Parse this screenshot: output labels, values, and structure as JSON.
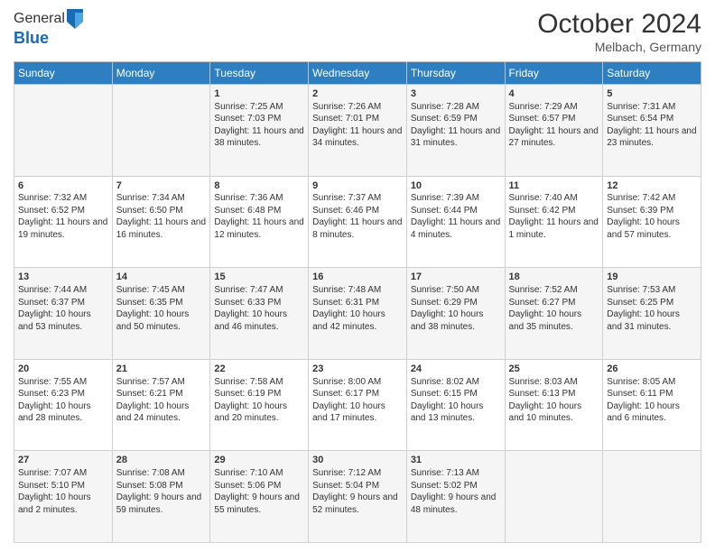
{
  "header": {
    "logo_line1": "General",
    "logo_line2": "Blue",
    "month": "October 2024",
    "location": "Melbach, Germany"
  },
  "days_of_week": [
    "Sunday",
    "Monday",
    "Tuesday",
    "Wednesday",
    "Thursday",
    "Friday",
    "Saturday"
  ],
  "weeks": [
    [
      {
        "day": "",
        "info": ""
      },
      {
        "day": "",
        "info": ""
      },
      {
        "day": "1",
        "info": "Sunrise: 7:25 AM\nSunset: 7:03 PM\nDaylight: 11 hours and 38 minutes."
      },
      {
        "day": "2",
        "info": "Sunrise: 7:26 AM\nSunset: 7:01 PM\nDaylight: 11 hours and 34 minutes."
      },
      {
        "day": "3",
        "info": "Sunrise: 7:28 AM\nSunset: 6:59 PM\nDaylight: 11 hours and 31 minutes."
      },
      {
        "day": "4",
        "info": "Sunrise: 7:29 AM\nSunset: 6:57 PM\nDaylight: 11 hours and 27 minutes."
      },
      {
        "day": "5",
        "info": "Sunrise: 7:31 AM\nSunset: 6:54 PM\nDaylight: 11 hours and 23 minutes."
      }
    ],
    [
      {
        "day": "6",
        "info": "Sunrise: 7:32 AM\nSunset: 6:52 PM\nDaylight: 11 hours and 19 minutes."
      },
      {
        "day": "7",
        "info": "Sunrise: 7:34 AM\nSunset: 6:50 PM\nDaylight: 11 hours and 16 minutes."
      },
      {
        "day": "8",
        "info": "Sunrise: 7:36 AM\nSunset: 6:48 PM\nDaylight: 11 hours and 12 minutes."
      },
      {
        "day": "9",
        "info": "Sunrise: 7:37 AM\nSunset: 6:46 PM\nDaylight: 11 hours and 8 minutes."
      },
      {
        "day": "10",
        "info": "Sunrise: 7:39 AM\nSunset: 6:44 PM\nDaylight: 11 hours and 4 minutes."
      },
      {
        "day": "11",
        "info": "Sunrise: 7:40 AM\nSunset: 6:42 PM\nDaylight: 11 hours and 1 minute."
      },
      {
        "day": "12",
        "info": "Sunrise: 7:42 AM\nSunset: 6:39 PM\nDaylight: 10 hours and 57 minutes."
      }
    ],
    [
      {
        "day": "13",
        "info": "Sunrise: 7:44 AM\nSunset: 6:37 PM\nDaylight: 10 hours and 53 minutes."
      },
      {
        "day": "14",
        "info": "Sunrise: 7:45 AM\nSunset: 6:35 PM\nDaylight: 10 hours and 50 minutes."
      },
      {
        "day": "15",
        "info": "Sunrise: 7:47 AM\nSunset: 6:33 PM\nDaylight: 10 hours and 46 minutes."
      },
      {
        "day": "16",
        "info": "Sunrise: 7:48 AM\nSunset: 6:31 PM\nDaylight: 10 hours and 42 minutes."
      },
      {
        "day": "17",
        "info": "Sunrise: 7:50 AM\nSunset: 6:29 PM\nDaylight: 10 hours and 38 minutes."
      },
      {
        "day": "18",
        "info": "Sunrise: 7:52 AM\nSunset: 6:27 PM\nDaylight: 10 hours and 35 minutes."
      },
      {
        "day": "19",
        "info": "Sunrise: 7:53 AM\nSunset: 6:25 PM\nDaylight: 10 hours and 31 minutes."
      }
    ],
    [
      {
        "day": "20",
        "info": "Sunrise: 7:55 AM\nSunset: 6:23 PM\nDaylight: 10 hours and 28 minutes."
      },
      {
        "day": "21",
        "info": "Sunrise: 7:57 AM\nSunset: 6:21 PM\nDaylight: 10 hours and 24 minutes."
      },
      {
        "day": "22",
        "info": "Sunrise: 7:58 AM\nSunset: 6:19 PM\nDaylight: 10 hours and 20 minutes."
      },
      {
        "day": "23",
        "info": "Sunrise: 8:00 AM\nSunset: 6:17 PM\nDaylight: 10 hours and 17 minutes."
      },
      {
        "day": "24",
        "info": "Sunrise: 8:02 AM\nSunset: 6:15 PM\nDaylight: 10 hours and 13 minutes."
      },
      {
        "day": "25",
        "info": "Sunrise: 8:03 AM\nSunset: 6:13 PM\nDaylight: 10 hours and 10 minutes."
      },
      {
        "day": "26",
        "info": "Sunrise: 8:05 AM\nSunset: 6:11 PM\nDaylight: 10 hours and 6 minutes."
      }
    ],
    [
      {
        "day": "27",
        "info": "Sunrise: 7:07 AM\nSunset: 5:10 PM\nDaylight: 10 hours and 2 minutes."
      },
      {
        "day": "28",
        "info": "Sunrise: 7:08 AM\nSunset: 5:08 PM\nDaylight: 9 hours and 59 minutes."
      },
      {
        "day": "29",
        "info": "Sunrise: 7:10 AM\nSunset: 5:06 PM\nDaylight: 9 hours and 55 minutes."
      },
      {
        "day": "30",
        "info": "Sunrise: 7:12 AM\nSunset: 5:04 PM\nDaylight: 9 hours and 52 minutes."
      },
      {
        "day": "31",
        "info": "Sunrise: 7:13 AM\nSunset: 5:02 PM\nDaylight: 9 hours and 48 minutes."
      },
      {
        "day": "",
        "info": ""
      },
      {
        "day": "",
        "info": ""
      }
    ]
  ]
}
